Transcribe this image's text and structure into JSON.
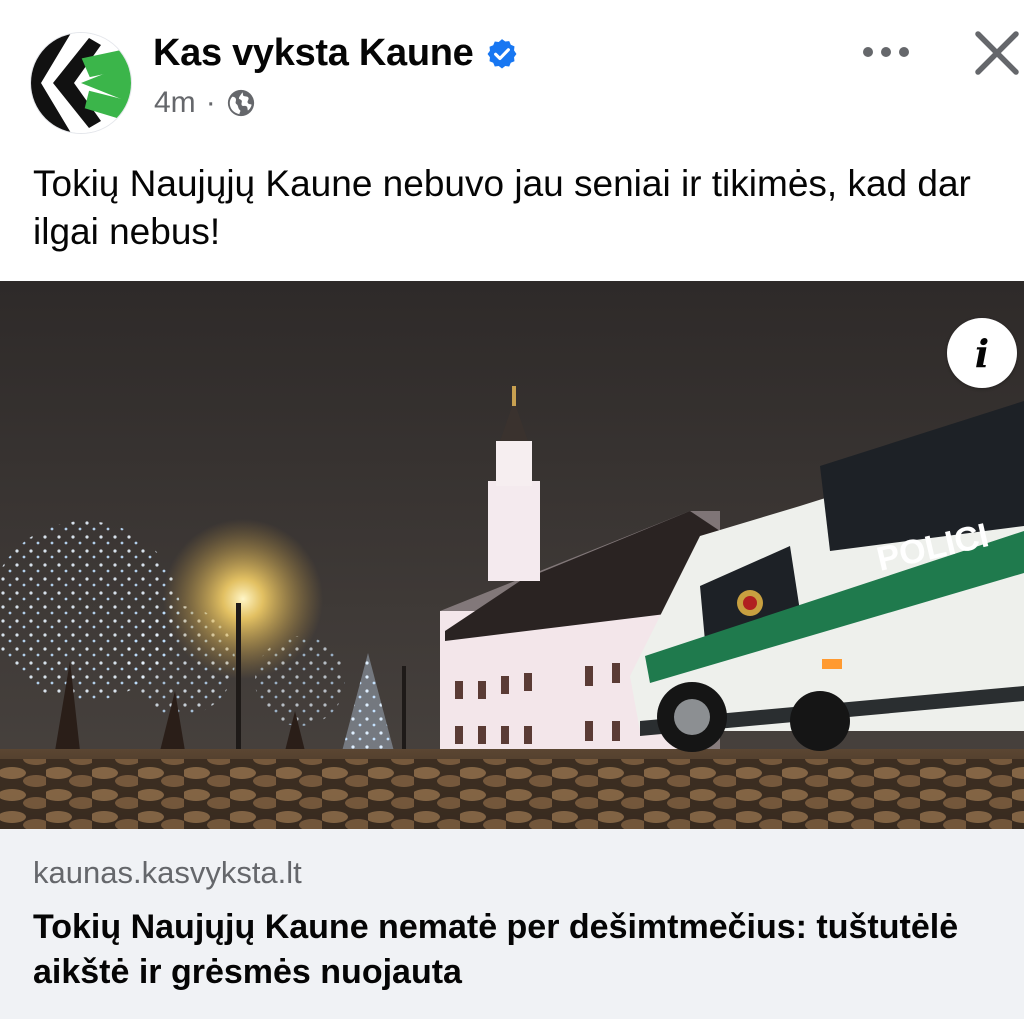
{
  "post": {
    "author": "Kas vyksta Kaune",
    "verified": true,
    "time": "4m",
    "separator": "·",
    "audience_icon": "globe-icon",
    "caption": "Tokių Naujųjų Kaune nebuvo jau seniai ir tikimės, kad dar ilgai nebus!"
  },
  "header_actions": {
    "more_icon": "more-horizontal-icon",
    "close_icon": "close-icon"
  },
  "media": {
    "van_text": "POLICI",
    "info_label": "i"
  },
  "link_preview": {
    "domain": "kaunas.kasvyksta.lt",
    "title": "Tokių Naujųjų Kaune nematė per dešimtmečius: tuštutėlė aikštė ir grėsmės nuojauta"
  },
  "colors": {
    "verified": "#1877f2",
    "secondary_text": "#65676b",
    "card_bg": "#f0f2f5",
    "brand_green": "#3bb54a"
  }
}
